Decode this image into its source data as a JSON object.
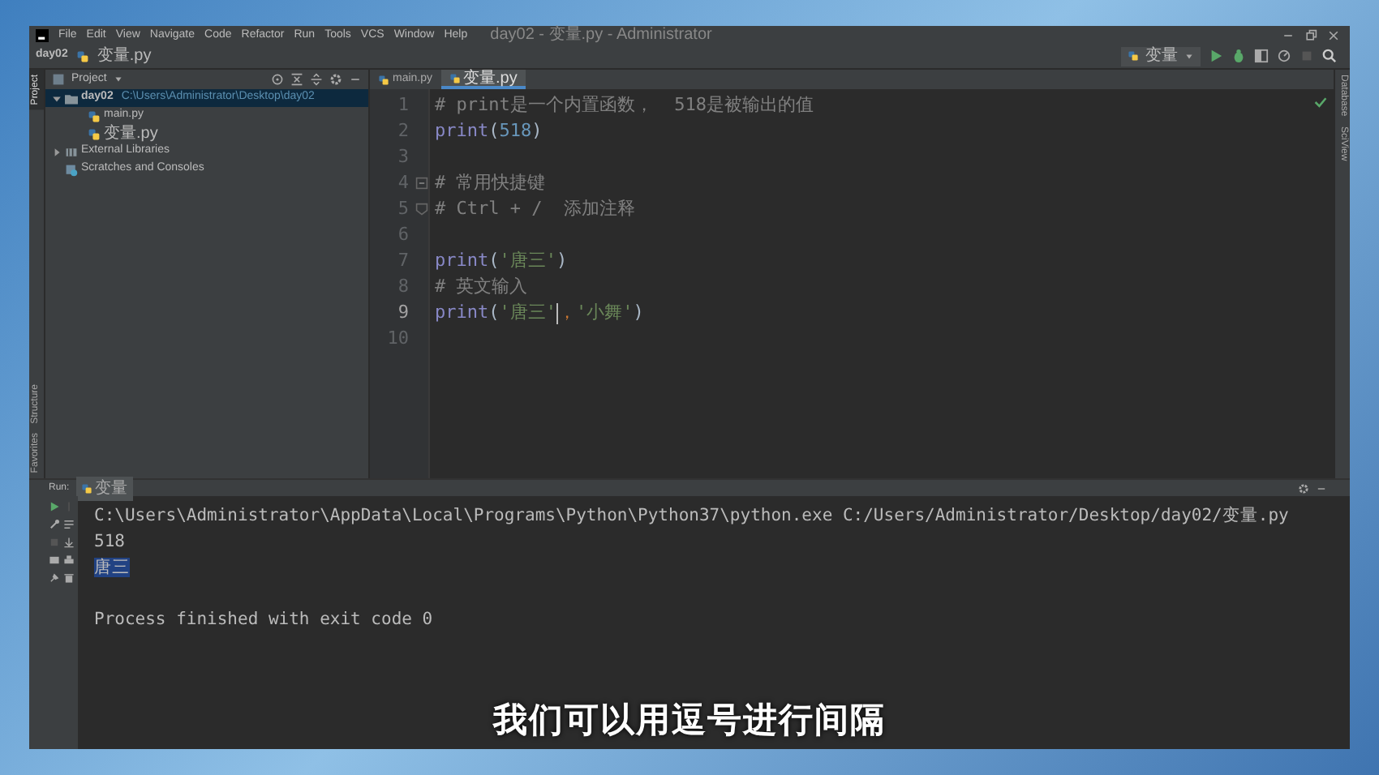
{
  "menu_bar": {
    "items": [
      "File",
      "Edit",
      "View",
      "Navigate",
      "Code",
      "Refactor",
      "Run",
      "Tools",
      "VCS",
      "Window",
      "Help"
    ],
    "title": "day02 - 变量.py - Administrator"
  },
  "navigation_bar": {
    "breadcrumbs": [
      "day02",
      "变量.py"
    ],
    "run_configuration": "变量"
  },
  "left_tool_windows": [
    {
      "label": "Project",
      "kind": "top",
      "selected": true
    },
    {
      "label": "Structure",
      "kind": "bottom",
      "selected": false
    },
    {
      "label": "Favorites",
      "kind": "bottom",
      "selected": false
    }
  ],
  "right_tool_windows": [
    {
      "label": "Database",
      "selected": false
    },
    {
      "label": "SciView",
      "selected": false
    }
  ],
  "project_panel": {
    "title": "Project",
    "tree": [
      {
        "label": "day02",
        "path": "C:\\Users\\Administrator\\Desktop\\day02",
        "kind": "folder",
        "expanded": true,
        "selected": true,
        "children": [
          {
            "label": "main.py",
            "kind": "python-file",
            "selected": false
          },
          {
            "label": "变量.py",
            "kind": "python-file",
            "selected": false
          }
        ]
      },
      {
        "label": "External Libraries",
        "kind": "library",
        "expanded": false,
        "selected": false
      },
      {
        "label": "Scratches and Consoles",
        "kind": "scratches",
        "selected": false
      }
    ]
  },
  "editor": {
    "tabs": [
      {
        "label": "main.py",
        "selected": false
      },
      {
        "label": "变量.py",
        "selected": true
      }
    ],
    "lines": [
      {
        "number": "1",
        "current": false,
        "tokens": [
          {
            "kind": "comment",
            "text": "# print是一个内置函数，  518是被输出的值"
          }
        ]
      },
      {
        "number": "2",
        "current": false,
        "tokens": [
          {
            "kind": "builtin",
            "text": "print"
          },
          {
            "kind": "paren",
            "text": "("
          },
          {
            "kind": "number",
            "text": "518"
          },
          {
            "kind": "paren",
            "text": ")"
          }
        ]
      },
      {
        "number": "3",
        "current": false
      },
      {
        "number": "4",
        "current": false,
        "kind": "fold-start",
        "tokens": [
          {
            "kind": "comment",
            "text": "# 常用快捷键"
          }
        ]
      },
      {
        "number": "5",
        "current": false,
        "kind": "fold-end",
        "tokens": [
          {
            "kind": "comment",
            "text": "# Ctrl + /  添加注释"
          }
        ]
      },
      {
        "number": "6",
        "current": false
      },
      {
        "number": "7",
        "current": false,
        "tokens": [
          {
            "kind": "builtin",
            "text": "print"
          },
          {
            "kind": "paren",
            "text": "("
          },
          {
            "kind": "string",
            "text": "'唐三'"
          },
          {
            "kind": "paren",
            "text": ")"
          }
        ]
      },
      {
        "number": "8",
        "current": false,
        "tokens": [
          {
            "kind": "comment",
            "text": "# 英文输入"
          }
        ]
      },
      {
        "number": "9",
        "current": true,
        "tokens": [
          {
            "kind": "builtin",
            "text": "print"
          },
          {
            "kind": "paren",
            "text": "("
          },
          {
            "kind": "string",
            "text": "'唐三'",
            "caret": true
          },
          {
            "kind": "warning",
            "text": "，"
          },
          {
            "kind": "string",
            "text": "'小舞'"
          },
          {
            "kind": "paren",
            "text": ")"
          }
        ]
      },
      {
        "number": "10",
        "current": false
      }
    ]
  },
  "run_panel": {
    "label": "Run:",
    "tabs": [
      {
        "label": "变量",
        "selected": true
      }
    ],
    "console": [
      {
        "kind": "command",
        "text": "C:\\Users\\Administrator\\AppData\\Local\\Programs\\Python\\Python37\\python.exe C:/Users/Administrator/Desktop/day02/变量.py",
        "selected": false
      },
      {
        "kind": "output",
        "text": "518",
        "selected": false
      },
      {
        "kind": "output",
        "text": "唐三",
        "selected": true
      },
      {
        "kind": "status",
        "text": "Process finished with exit code 0",
        "selected": false
      }
    ]
  },
  "subtitle": "我们可以用逗号进行间隔"
}
